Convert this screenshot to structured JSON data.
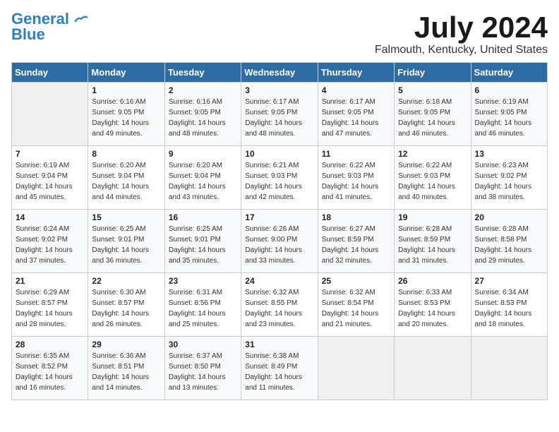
{
  "header": {
    "logo_line1": "General",
    "logo_line2": "Blue",
    "month_title": "July 2024",
    "location": "Falmouth, Kentucky, United States"
  },
  "days_of_week": [
    "Sunday",
    "Monday",
    "Tuesday",
    "Wednesday",
    "Thursday",
    "Friday",
    "Saturday"
  ],
  "weeks": [
    [
      {
        "day": "",
        "empty": true
      },
      {
        "day": "1",
        "sunrise": "6:16 AM",
        "sunset": "9:05 PM",
        "daylight": "14 hours and 49 minutes."
      },
      {
        "day": "2",
        "sunrise": "6:16 AM",
        "sunset": "9:05 PM",
        "daylight": "14 hours and 48 minutes."
      },
      {
        "day": "3",
        "sunrise": "6:17 AM",
        "sunset": "9:05 PM",
        "daylight": "14 hours and 48 minutes."
      },
      {
        "day": "4",
        "sunrise": "6:17 AM",
        "sunset": "9:05 PM",
        "daylight": "14 hours and 47 minutes."
      },
      {
        "day": "5",
        "sunrise": "6:18 AM",
        "sunset": "9:05 PM",
        "daylight": "14 hours and 46 minutes."
      },
      {
        "day": "6",
        "sunrise": "6:19 AM",
        "sunset": "9:05 PM",
        "daylight": "14 hours and 46 minutes."
      }
    ],
    [
      {
        "day": "7",
        "sunrise": "6:19 AM",
        "sunset": "9:04 PM",
        "daylight": "14 hours and 45 minutes."
      },
      {
        "day": "8",
        "sunrise": "6:20 AM",
        "sunset": "9:04 PM",
        "daylight": "14 hours and 44 minutes."
      },
      {
        "day": "9",
        "sunrise": "6:20 AM",
        "sunset": "9:04 PM",
        "daylight": "14 hours and 43 minutes."
      },
      {
        "day": "10",
        "sunrise": "6:21 AM",
        "sunset": "9:03 PM",
        "daylight": "14 hours and 42 minutes."
      },
      {
        "day": "11",
        "sunrise": "6:22 AM",
        "sunset": "9:03 PM",
        "daylight": "14 hours and 41 minutes."
      },
      {
        "day": "12",
        "sunrise": "6:22 AM",
        "sunset": "9:03 PM",
        "daylight": "14 hours and 40 minutes."
      },
      {
        "day": "13",
        "sunrise": "6:23 AM",
        "sunset": "9:02 PM",
        "daylight": "14 hours and 38 minutes."
      }
    ],
    [
      {
        "day": "14",
        "sunrise": "6:24 AM",
        "sunset": "9:02 PM",
        "daylight": "14 hours and 37 minutes."
      },
      {
        "day": "15",
        "sunrise": "6:25 AM",
        "sunset": "9:01 PM",
        "daylight": "14 hours and 36 minutes."
      },
      {
        "day": "16",
        "sunrise": "6:25 AM",
        "sunset": "9:01 PM",
        "daylight": "14 hours and 35 minutes."
      },
      {
        "day": "17",
        "sunrise": "6:26 AM",
        "sunset": "9:00 PM",
        "daylight": "14 hours and 33 minutes."
      },
      {
        "day": "18",
        "sunrise": "6:27 AM",
        "sunset": "8:59 PM",
        "daylight": "14 hours and 32 minutes."
      },
      {
        "day": "19",
        "sunrise": "6:28 AM",
        "sunset": "8:59 PM",
        "daylight": "14 hours and 31 minutes."
      },
      {
        "day": "20",
        "sunrise": "6:28 AM",
        "sunset": "8:58 PM",
        "daylight": "14 hours and 29 minutes."
      }
    ],
    [
      {
        "day": "21",
        "sunrise": "6:29 AM",
        "sunset": "8:57 PM",
        "daylight": "14 hours and 28 minutes."
      },
      {
        "day": "22",
        "sunrise": "6:30 AM",
        "sunset": "8:57 PM",
        "daylight": "14 hours and 26 minutes."
      },
      {
        "day": "23",
        "sunrise": "6:31 AM",
        "sunset": "8:56 PM",
        "daylight": "14 hours and 25 minutes."
      },
      {
        "day": "24",
        "sunrise": "6:32 AM",
        "sunset": "8:55 PM",
        "daylight": "14 hours and 23 minutes."
      },
      {
        "day": "25",
        "sunrise": "6:32 AM",
        "sunset": "8:54 PM",
        "daylight": "14 hours and 21 minutes."
      },
      {
        "day": "26",
        "sunrise": "6:33 AM",
        "sunset": "8:53 PM",
        "daylight": "14 hours and 20 minutes."
      },
      {
        "day": "27",
        "sunrise": "6:34 AM",
        "sunset": "8:53 PM",
        "daylight": "14 hours and 18 minutes."
      }
    ],
    [
      {
        "day": "28",
        "sunrise": "6:35 AM",
        "sunset": "8:52 PM",
        "daylight": "14 hours and 16 minutes."
      },
      {
        "day": "29",
        "sunrise": "6:36 AM",
        "sunset": "8:51 PM",
        "daylight": "14 hours and 14 minutes."
      },
      {
        "day": "30",
        "sunrise": "6:37 AM",
        "sunset": "8:50 PM",
        "daylight": "14 hours and 13 minutes."
      },
      {
        "day": "31",
        "sunrise": "6:38 AM",
        "sunset": "8:49 PM",
        "daylight": "14 hours and 11 minutes."
      },
      {
        "day": "",
        "empty": true
      },
      {
        "day": "",
        "empty": true
      },
      {
        "day": "",
        "empty": true
      }
    ]
  ]
}
